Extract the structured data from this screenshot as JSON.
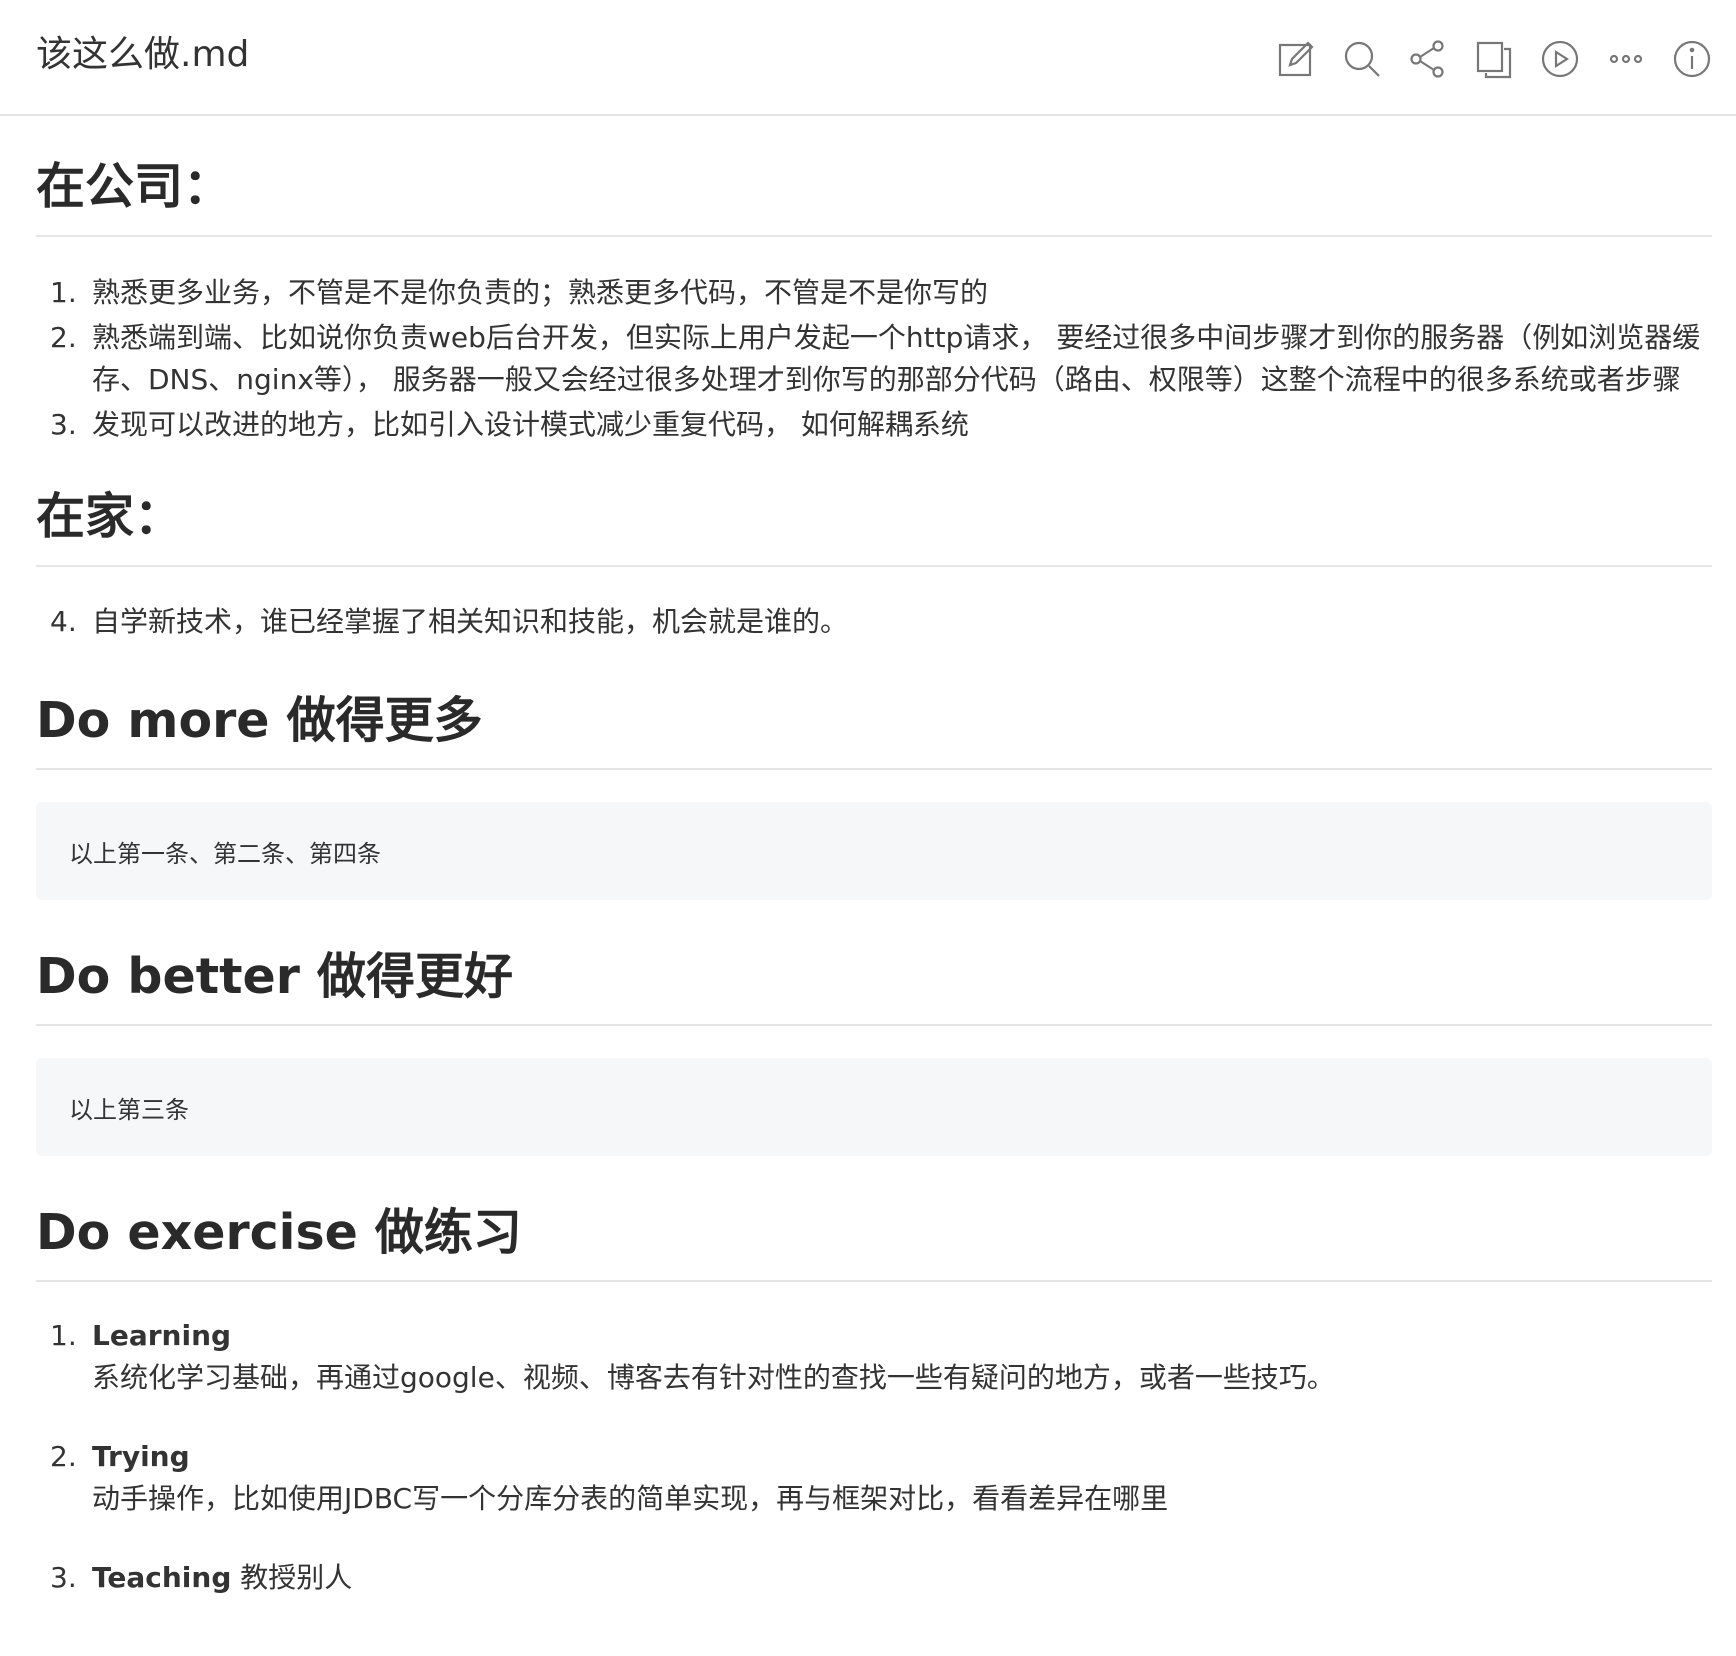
{
  "header": {
    "title": "该这么做.md",
    "toolbar": [
      "edit-icon",
      "search-icon",
      "share-icon",
      "copy-icon",
      "play-icon",
      "more-icon",
      "info-icon"
    ]
  },
  "sections": {
    "company": {
      "heading": "在公司：",
      "items": [
        "熟悉更多业务，不管是不是你负责的；熟悉更多代码，不管是不是你写的",
        "熟悉端到端、比如说你负责web后台开发，但实际上用户发起一个http请求， 要经过很多中间步骤才到你的服务器（例如浏览器缓存、DNS、nginx等）， 服务器一般又会经过很多处理才到你写的那部分代码（路由、权限等）这整个流程中的很多系统或者步骤",
        "发现可以改进的地方，比如引入设计模式减少重复代码， 如何解耦系统"
      ]
    },
    "home": {
      "heading": "在家：",
      "items": [
        "自学新技术，谁已经掌握了相关知识和技能，机会就是谁的。"
      ]
    },
    "do_more": {
      "heading": "Do more 做得更多",
      "block": "以上第一条、第二条、第四条"
    },
    "do_better": {
      "heading": "Do better 做得更好",
      "block": "以上第三条"
    },
    "do_exercise": {
      "heading": "Do exercise 做练习",
      "items": [
        {
          "head": "Learning",
          "body": "系统化学习基础，再通过google、视频、博客去有针对性的查找一些有疑问的地方，或者一些技巧。"
        },
        {
          "head": "Trying",
          "body": "动手操作，比如使用JDBC写一个分库分表的简单实现，再与框架对比，看看差异在哪里"
        },
        {
          "head": "Teaching",
          "tail": "教授别人"
        }
      ]
    }
  },
  "list_numbers": [
    "1.",
    "2.",
    "3.",
    "4."
  ]
}
